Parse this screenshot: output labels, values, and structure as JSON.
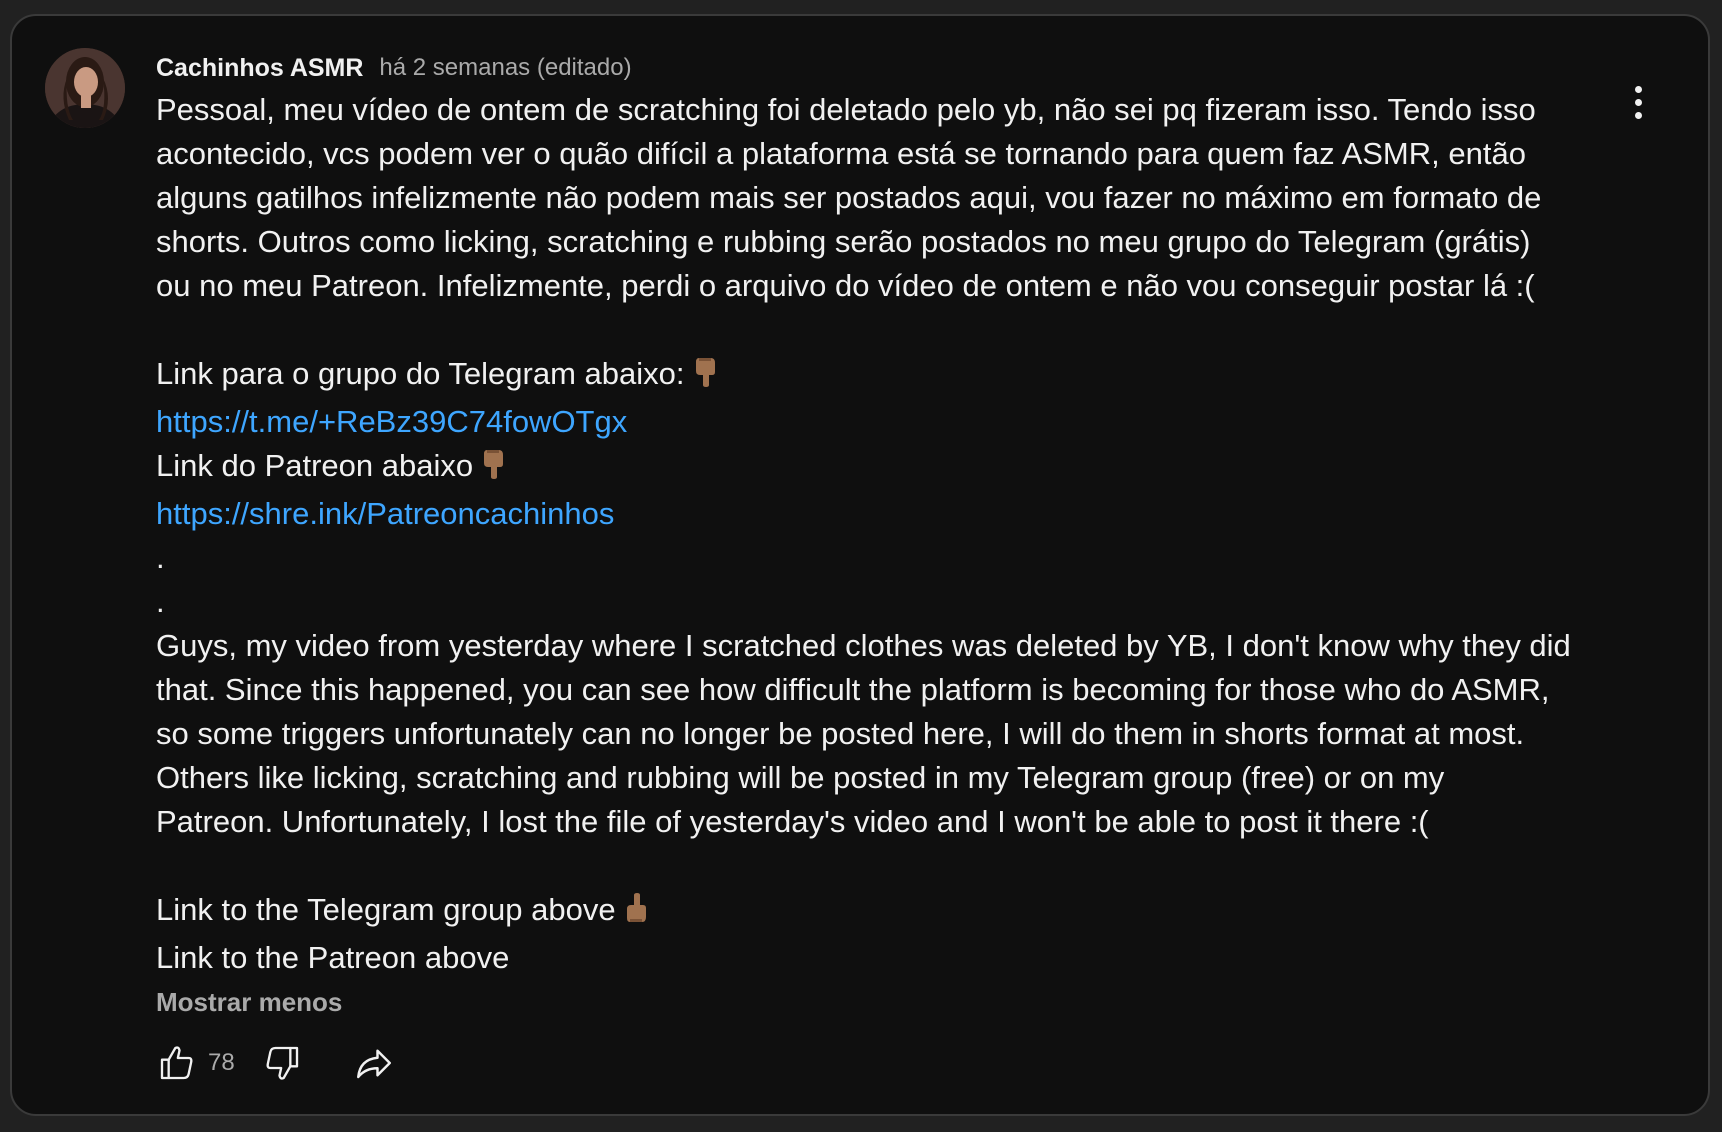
{
  "comment": {
    "author": "Cachinhos ASMR",
    "time": "há 2 semanas (editado)",
    "lines": [
      {
        "text": "Pessoal, meu vídeo de ontem de scratching foi deletado pelo yb, não sei pq fizeram isso. Tendo isso"
      },
      {
        "text": "acontecido, vcs podem ver o quão difícil a plataforma está se tornando para quem faz ASMR, então"
      },
      {
        "text": "alguns gatilhos infelizmente não podem mais ser postados aqui, vou fazer no máximo em formato de"
      },
      {
        "text": "shorts. Outros como licking, scratching e rubbing serão postados no meu grupo do Telegram (grátis)"
      },
      {
        "text": "ou no meu Patreon. Infelizmente, perdi o arquivo do vídeo de ontem e não vou conseguir postar lá :("
      },
      {
        "text": ""
      },
      {
        "text": "Link para o grupo do Telegram abaixo:"
      },
      {
        "link": "https://t.me/+ReBz39C74fowOTgx"
      },
      {
        "text": "Link do Patreon abaixo"
      },
      {
        "link": "https://shre.ink/Patreoncachinhos"
      },
      {
        "text": "."
      },
      {
        "text": "."
      },
      {
        "text": "Guys, my video from yesterday where I scratched clothes was deleted by YB, I don't know why they did"
      },
      {
        "text": "that. Since this happened, you can see how difficult the platform is becoming for those who do ASMR,"
      },
      {
        "text": "so some triggers unfortunately can no longer be posted here, I will do them in shorts format at most."
      },
      {
        "text": "Others like licking, scratching and rubbing will be posted in my Telegram group (free) or on my"
      },
      {
        "text": "Patreon. Unfortunately, I lost the file of yesterday's video and I won't be able to post it there :("
      },
      {
        "text": ""
      },
      {
        "text": "Link to the Telegram group above"
      },
      {
        "text": "Link to the Patreon above"
      }
    ],
    "show_less": "Mostrar menos",
    "like_count": "78",
    "emojis": {
      "point_down": "backhand-index-pointing-down-icon",
      "point_up": "backhand-index-pointing-up-icon"
    },
    "colors": {
      "link": "#3ea6ff",
      "background": "#0f0f0f",
      "text": "#f1f1f1",
      "muted": "#aaaaaa"
    }
  }
}
